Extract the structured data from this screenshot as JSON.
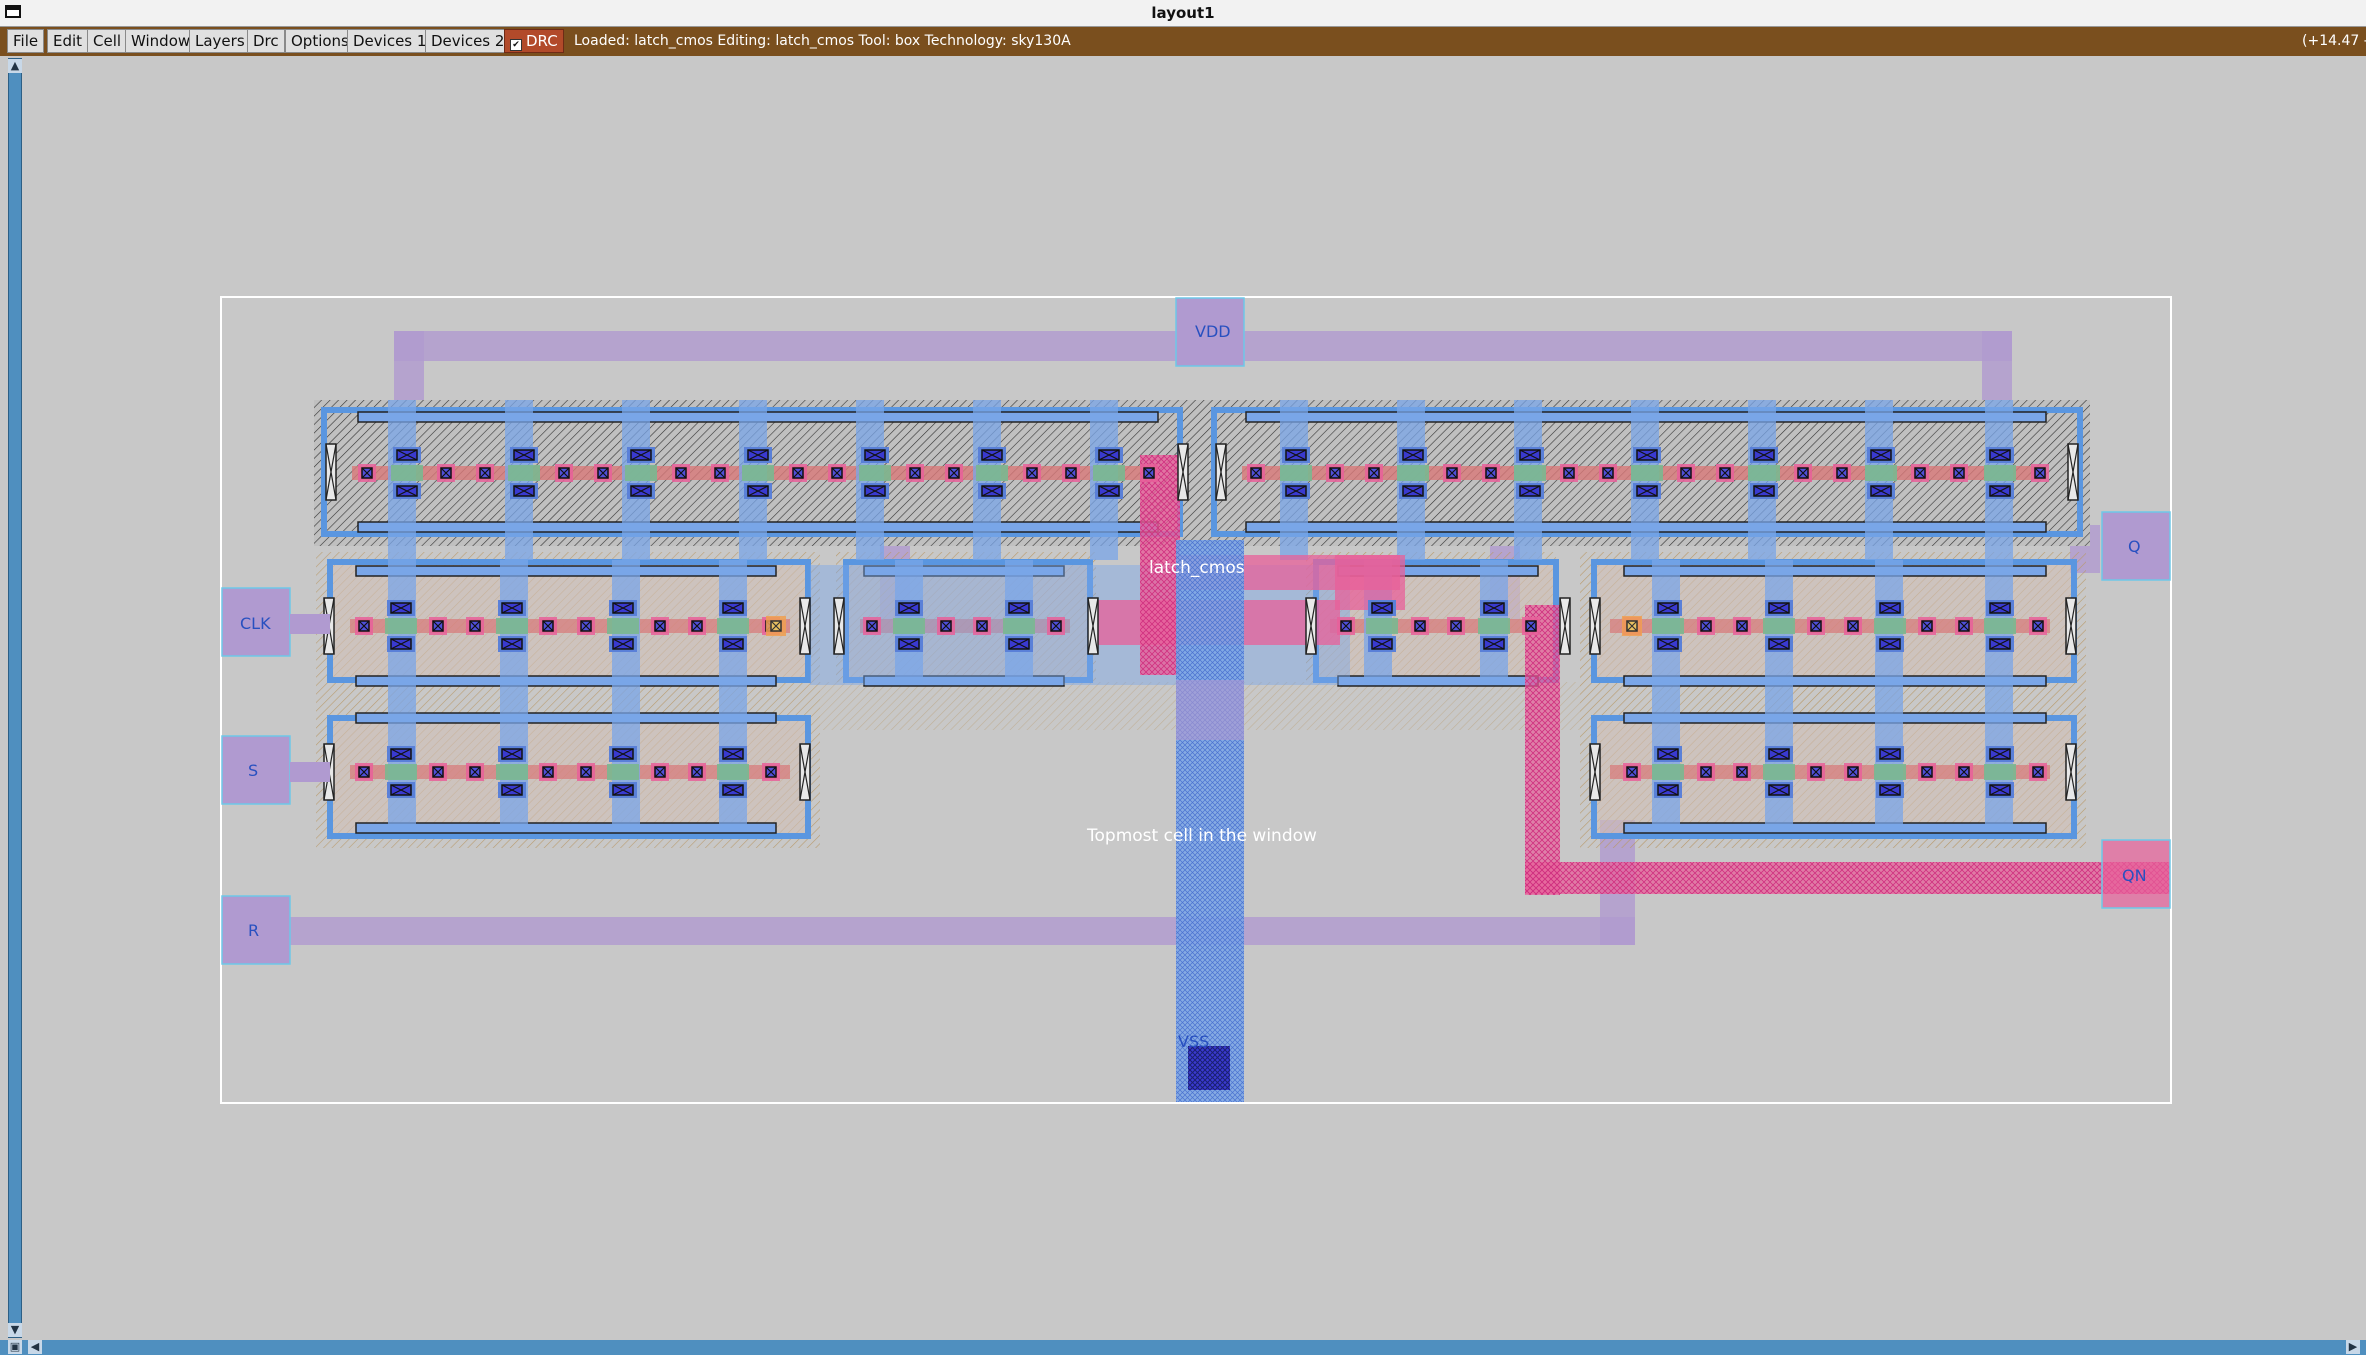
{
  "window": {
    "title": "layout1"
  },
  "menu": {
    "items": [
      "File",
      "Edit",
      "Cell",
      "Window",
      "Layers",
      "Drc",
      "Options",
      "Devices 1",
      "Devices 2"
    ],
    "drc_toggle_label": "DRC",
    "drc_checked": true
  },
  "status": {
    "text": "Loaded: latch_cmos Editing: latch_cmos Tool: box  Technology: sky130A",
    "coords": "(+14.47 -"
  },
  "canvas": {
    "cell_name": "latch_cmos",
    "topmost_label": "Topmost cell in the window",
    "pins": {
      "vdd": "VDD",
      "vss": "VSS",
      "clk": "CLK",
      "s": "S",
      "r": "R",
      "q": "Q",
      "qn": "QN"
    }
  },
  "colors": {
    "menubar": "#7a4f1e",
    "background": "#c8c8c8",
    "metal1": "#b09ad0",
    "poly": "#e8609a",
    "locali": "#7aa6e8",
    "nwell": "#c8b890",
    "diffusion": "#b8a0c0",
    "scrollbar": "#4f8fbf",
    "pin_text": "#2850c0"
  }
}
